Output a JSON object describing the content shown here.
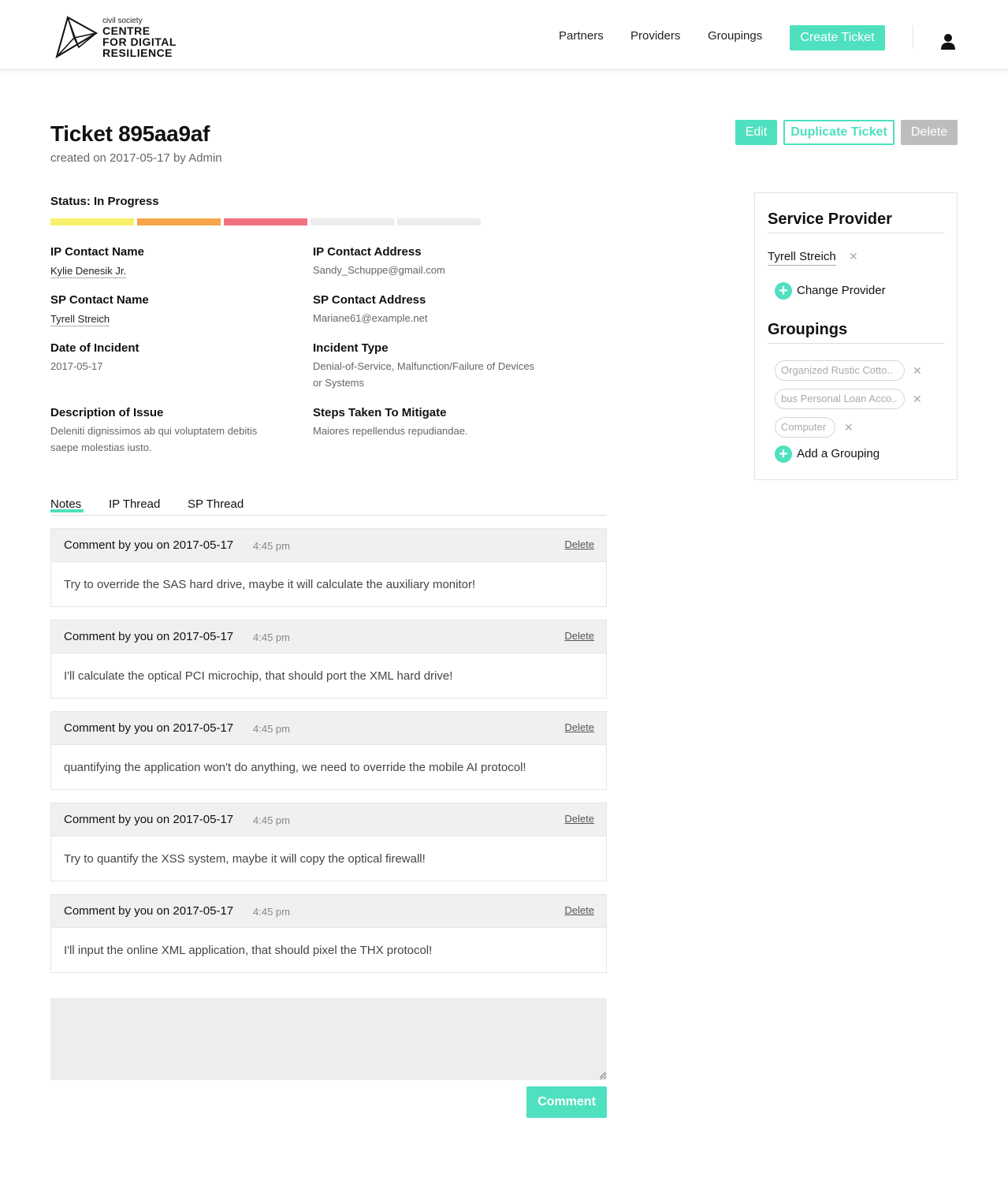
{
  "brand": {
    "small": "civil society",
    "line1": "CENTRE",
    "line2": "FOR DIGITAL",
    "line3": "RESILIENCE"
  },
  "nav": {
    "partners": "Partners",
    "providers": "Providers",
    "groupings": "Groupings",
    "create_ticket": "Create Ticket",
    "user_icon": "user-icon"
  },
  "ticket": {
    "title": "Ticket 895aa9af",
    "meta": "created on 2017-05-17 by Admin",
    "actions": {
      "edit": "Edit",
      "duplicate": "Duplicate Ticket",
      "delete": "Delete"
    },
    "status": {
      "label": "Status: In Progress",
      "steps_filled": 3,
      "steps_total": 5,
      "colors": [
        "#f7f06a",
        "#f6a54a",
        "#f3717f",
        "#ececec",
        "#ececec"
      ]
    },
    "fields": {
      "ip_contact_name_label": "IP Contact Name",
      "ip_contact_name": "Kylie Denesik Jr.",
      "ip_contact_address_label": "IP Contact Address",
      "ip_contact_address": "Sandy_Schuppe@gmail.com",
      "sp_contact_name_label": "SP Contact Name",
      "sp_contact_name": "Tyrell Streich",
      "sp_contact_address_label": "SP Contact Address",
      "sp_contact_address": "Mariane61@example.net",
      "date_label": "Date of Incident",
      "date": "2017-05-17",
      "incident_type_label": "Incident Type",
      "incident_type_line1": "Denial-of-Service, Malfunction/Failure of Devices",
      "incident_type_line2": "or Systems",
      "description_label": "Description of Issue",
      "description_line1": "Deleniti dignissimos ab qui voluptatem debitis",
      "description_line2": "saepe molestias iusto.",
      "steps_label": "Steps Taken To Mitigate",
      "steps": "Maiores repellendus repudiandae."
    }
  },
  "tabs": {
    "notes": "Notes",
    "ip_thread": "IP Thread",
    "sp_thread": "SP Thread",
    "active": "Notes"
  },
  "comments": [
    {
      "by": "Comment by you on 2017-05-17",
      "time": "4:45 pm",
      "delete": "Delete",
      "text": "Try to override the SAS hard drive, maybe it will calculate the auxiliary monitor!"
    },
    {
      "by": "Comment by you on 2017-05-17",
      "time": "4:45 pm",
      "delete": "Delete",
      "text": "I'll calculate the optical PCI microchip, that should port the XML hard drive!"
    },
    {
      "by": "Comment by you on 2017-05-17",
      "time": "4:45 pm",
      "delete": "Delete",
      "text": "quantifying the application won't do anything, we need to override the mobile AI protocol!"
    },
    {
      "by": "Comment by you on 2017-05-17",
      "time": "4:45 pm",
      "delete": "Delete",
      "text": "Try to quantify the XSS system, maybe it will copy the optical firewall!"
    },
    {
      "by": "Comment by you on 2017-05-17",
      "time": "4:45 pm",
      "delete": "Delete",
      "text": "I'll input the online XML application, that should pixel the THX protocol!"
    }
  ],
  "comment_form": {
    "value": "",
    "submit": "Comment"
  },
  "sidebar": {
    "provider_heading": "Service Provider",
    "provider_name": "Tyrell Streich",
    "change_provider": "Change Provider",
    "groupings_heading": "Groupings",
    "groupings": [
      "Organized Rustic Cotto..",
      "bus Personal Loan Acco..",
      "Computer"
    ],
    "add_grouping": "Add a Grouping"
  },
  "colors": {
    "accent": "#4fe0bf",
    "delete_button": "#bdbdbd"
  }
}
